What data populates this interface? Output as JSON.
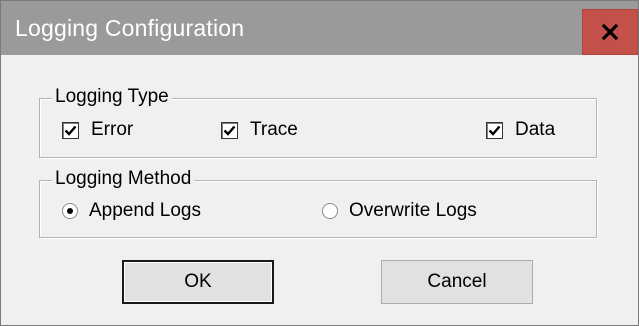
{
  "window": {
    "title": "Logging Configuration",
    "close_icon": "close-icon",
    "colors": {
      "titlebar": "#9a9a9a",
      "close_button": "#c4504a",
      "background": "#f0f0f0"
    }
  },
  "logging_type": {
    "legend": "Logging Type",
    "options": [
      {
        "label": "Error",
        "checked": true
      },
      {
        "label": "Trace",
        "checked": true
      },
      {
        "label": "Data",
        "checked": true
      }
    ]
  },
  "logging_method": {
    "legend": "Logging Method",
    "options": [
      {
        "label": "Append Logs",
        "selected": true
      },
      {
        "label": "Overwrite Logs",
        "selected": false
      }
    ]
  },
  "buttons": {
    "ok": "OK",
    "cancel": "Cancel"
  }
}
